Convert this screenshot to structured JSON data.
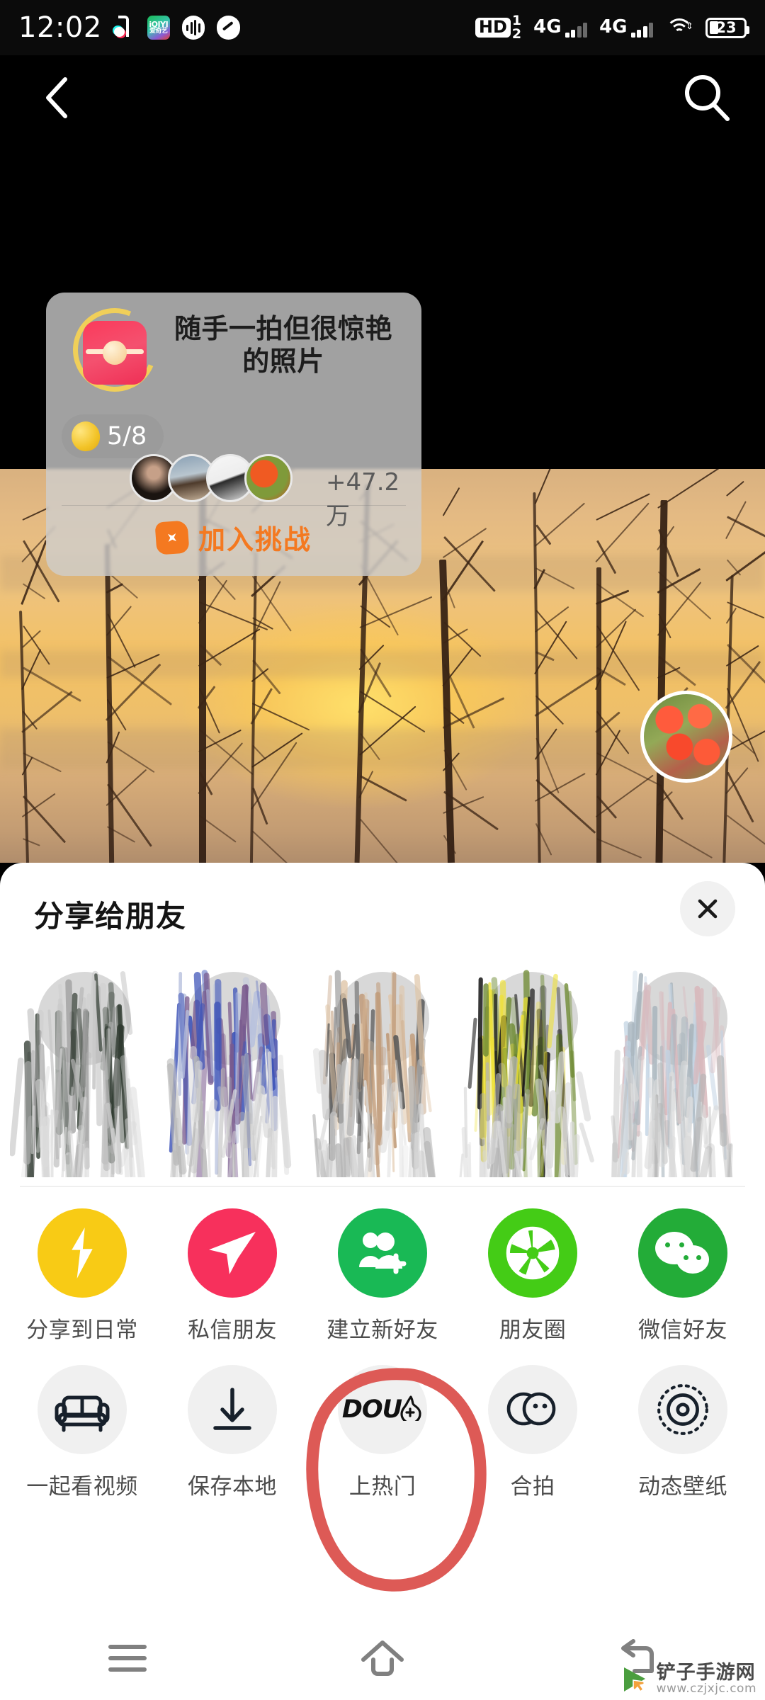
{
  "status_bar": {
    "time": "12:02",
    "left_icons": [
      "tiktok-icon",
      "iqiyi-icon",
      "audio-wave-icon",
      "speedometer-icon"
    ],
    "iqiyi_line1": "iQIYI",
    "iqiyi_line2": "爱奇艺",
    "hd_label": "HD",
    "sim1": "1",
    "sim2": "2",
    "net1": "4G",
    "net2": "4G",
    "battery": "23",
    "right_icons": [
      "hd-voice-icon",
      "signal-4g-sim1-icon",
      "signal-4g-sim2-icon",
      "wifi-icon",
      "battery-icon"
    ]
  },
  "top_nav": {
    "back_icon": "chevron-left-icon",
    "search_icon": "search-icon"
  },
  "challenge_card": {
    "title": "随手一拍但很惊艳的照片",
    "badge_icon": "gift-prop-icon",
    "progress": "5/8",
    "progress_icon": "lemon-icon",
    "participants_more": "+47.2万",
    "join_label": "加入挑战",
    "join_icon": "flame-plus-icon",
    "join_color": "#f47920",
    "avatars": [
      "avatar-person",
      "avatar-dog",
      "avatar-bw-photo",
      "avatar-flowers"
    ]
  },
  "floating_avatar": {
    "name": "author-avatar"
  },
  "share_sheet": {
    "title": "分享给朋友",
    "close_icon": "close-icon",
    "friends": [
      {
        "name": "",
        "scribble_colors": [
          "#2f3a30",
          "#9a9a9a",
          "#c9c9c9"
        ]
      },
      {
        "name": "",
        "scribble_colors": [
          "#3d53b8",
          "#7a5b8e",
          "#b9c2de"
        ]
      },
      {
        "name": "",
        "scribble_colors": [
          "#c09a78",
          "#e0c6a8",
          "#5a5a5a"
        ]
      },
      {
        "name": "",
        "scribble_colors": [
          "#6e8a32",
          "#171717",
          "#efe233"
        ]
      },
      {
        "name": "",
        "scribble_colors": [
          "#d9b9bd",
          "#c3d4e4",
          "#a9b5bd"
        ]
      }
    ],
    "row1": [
      {
        "label": "分享到日常",
        "icon": "lightning-bolt-icon",
        "bg": "#f8cb15",
        "style": "color"
      },
      {
        "label": "私信朋友",
        "icon": "paper-plane-icon",
        "bg": "#f7305c",
        "style": "color"
      },
      {
        "label": "建立新好友",
        "icon": "add-friend-icon",
        "bg": "#19b955",
        "style": "color"
      },
      {
        "label": "朋友圈",
        "icon": "wechat-moments-icon",
        "bg": "#44cc16",
        "style": "color"
      },
      {
        "label": "微信好友",
        "icon": "wechat-icon",
        "bg": "#23ac38",
        "style": "color"
      }
    ],
    "row2": [
      {
        "label": "一起看视频",
        "icon": "sofa-icon",
        "bg": "#f0f0f0",
        "style": "grey"
      },
      {
        "label": "保存本地",
        "icon": "download-icon",
        "bg": "#f0f0f0",
        "style": "grey"
      },
      {
        "label": "上热门",
        "icon": "dou-plus-icon",
        "bg": "#f0f0f0",
        "style": "grey",
        "icon_text": "DOU"
      },
      {
        "label": "合拍",
        "icon": "duet-icon",
        "bg": "#f0f0f0",
        "style": "grey"
      },
      {
        "label": "动态壁纸",
        "icon": "live-wallpaper-icon",
        "bg": "#f0f0f0",
        "style": "grey"
      }
    ]
  },
  "annotation": {
    "shape": "hand-drawn-circle",
    "color": "#dd5a56",
    "targets": "上热门"
  },
  "nav_bar": {
    "buttons": [
      {
        "name": "recents-button",
        "icon": "menu-lines-icon"
      },
      {
        "name": "home-button",
        "icon": "home-icon"
      },
      {
        "name": "back-button",
        "icon": "back-arrow-icon"
      }
    ]
  },
  "watermark": {
    "site_name": "铲子手游网",
    "site_url": "www.czjxjc.com",
    "logo_icon": "cursor-play-icon"
  }
}
